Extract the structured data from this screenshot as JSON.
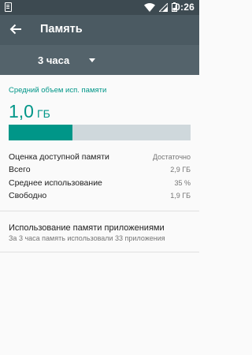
{
  "status_bar": {
    "time": "0:26",
    "icons": [
      "notification-icon",
      "wifi-icon",
      "signal-icon",
      "battery-icon"
    ]
  },
  "toolbar": {
    "title": "Память",
    "back_icon": "arrow-back-icon"
  },
  "period": {
    "selected": "3 часа"
  },
  "summary": {
    "title": "Средний объем исп. памяти",
    "value": "1,0",
    "unit": "ГБ",
    "usage_fraction": 0.35
  },
  "stats": [
    {
      "label": "Оценка доступной памяти",
      "value": "Достаточно"
    },
    {
      "label": "Всего",
      "value": "2,9 ГБ"
    },
    {
      "label": "Среднее использование",
      "value": "35 %"
    },
    {
      "label": "Свободно",
      "value": "1,9 ГБ"
    }
  ],
  "app_usage": {
    "title": "Использование памяти приложениями",
    "subtitle": "За 3 часа память использовали 33 приложения"
  },
  "colors": {
    "accent": "#009688",
    "status_bar": "#3d4a51",
    "toolbar": "#4b5a62",
    "spinner_bar": "#54636b",
    "progress_track": "#cfd8dc"
  }
}
